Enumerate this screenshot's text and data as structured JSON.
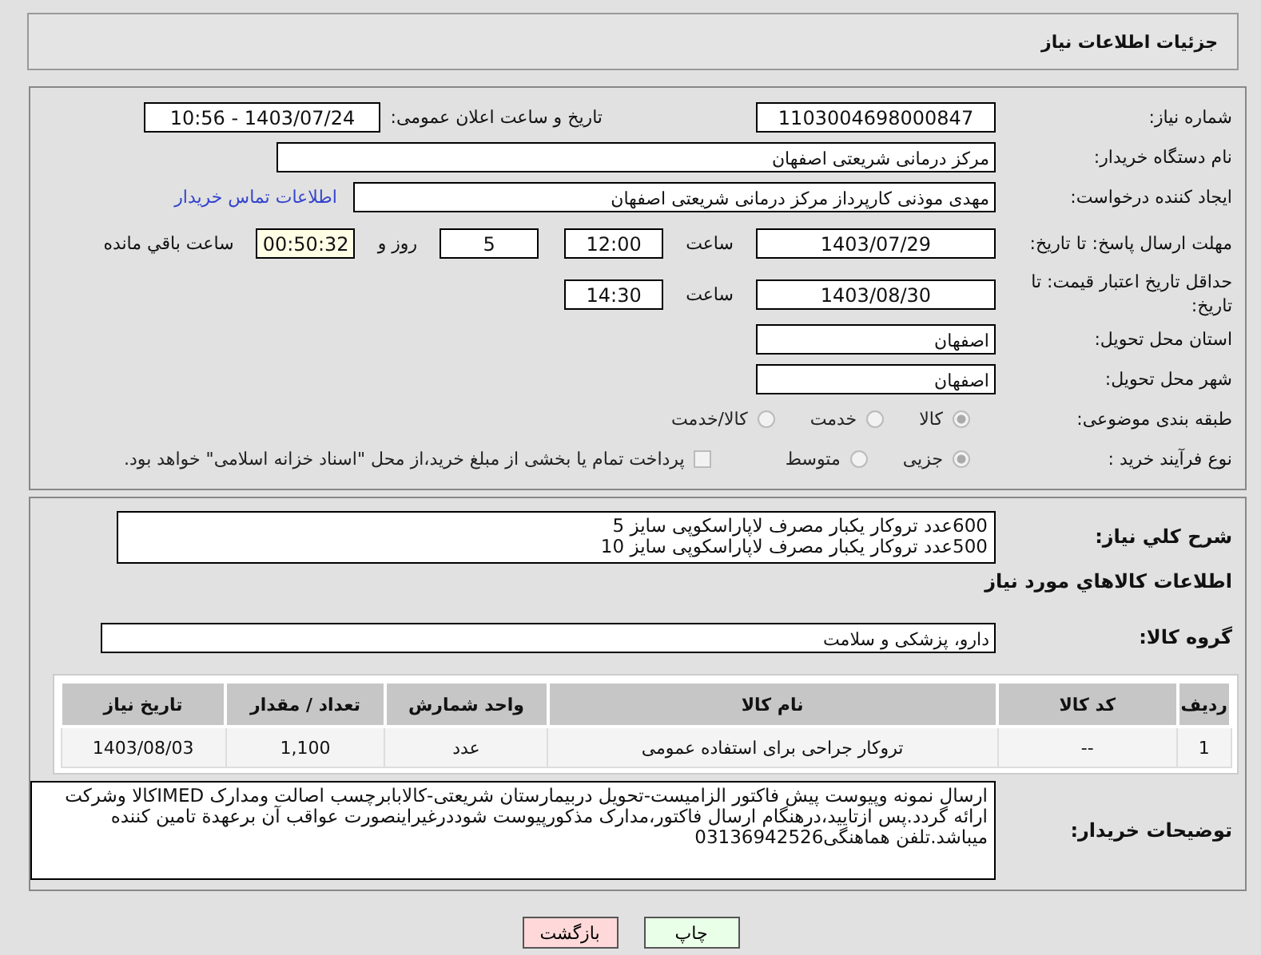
{
  "header": {
    "title": "جزئیات اطلاعات نیاز"
  },
  "need_number": {
    "label": "شماره نیاز:",
    "value": "1103004698000847"
  },
  "announce": {
    "label": "تاریخ و ساعت اعلان عمومی:",
    "value": "1403/07/24 - 10:56"
  },
  "buyer": {
    "label": "نام دستگاه خریدار:",
    "value": "مرکز درمانی شریعتی اصفهان"
  },
  "creator": {
    "label": "ایجاد کننده درخواست:",
    "value": "مهدی موذنی کارپرداز مرکز درمانی شریعتی اصفهان",
    "link": "اطلاعات تماس خریدار"
  },
  "deadline": {
    "label": "مهلت ارسال پاسخ: تا تاریخ:",
    "date": "1403/07/29",
    "time_label": "ساعت",
    "time": "12:00",
    "days": "5",
    "days_label": "روز و",
    "remaining": "00:50:32",
    "remaining_label": "ساعت باقي مانده"
  },
  "validity": {
    "label": "حداقل تاریخ اعتبار قیمت: تا تاریخ:",
    "date": "1403/08/30",
    "time_label": "ساعت",
    "time": "14:30"
  },
  "province": {
    "label": "استان محل تحویل:",
    "value": "اصفهان"
  },
  "city": {
    "label": "شهر محل تحویل:",
    "value": "اصفهان"
  },
  "category": {
    "label": "طبقه بندی موضوعی:",
    "options": [
      {
        "label": "کالا",
        "selected": true
      },
      {
        "label": "خدمت",
        "selected": false
      },
      {
        "label": "کالا/خدمت",
        "selected": false
      }
    ]
  },
  "process": {
    "label": "نوع فرآیند خرید :",
    "options": [
      {
        "label": "جزیی",
        "selected": true
      },
      {
        "label": "متوسط",
        "selected": false
      }
    ],
    "payment": {
      "label": "پرداخت تمام یا بخشی از مبلغ خرید،از محل \"اسناد خزانه اسلامی\" خواهد بود.",
      "checked": false
    }
  },
  "description": {
    "label": "شرح کلي نياز:",
    "lines": [
      "600عدد تروکار یکبار مصرف لاپاراسکوپی سایز 5",
      "500عدد تروکار یکبار مصرف لاپاراسکوپی سایز 10"
    ]
  },
  "goods_heading": "اطلاعات کالاهاي مورد نياز",
  "goods_group": {
    "label": "گروه کالا:",
    "value": "دارو، پزشکی و سلامت"
  },
  "table": {
    "columns": [
      "ردیف",
      "کد کالا",
      "نام کالا",
      "واحد شمارش",
      "تعداد / مقدار",
      "تاریخ نیاز"
    ],
    "rows": [
      [
        "1",
        "--",
        "تروکار جراحی برای استفاده عمومی",
        "عدد",
        "1,100",
        "1403/08/03"
      ]
    ]
  },
  "buyer_notes": {
    "label": "توضیحات خریدار:",
    "value": "ارسال نمونه وپیوست پیش فاکتور الزامیست-تحویل دربیمارستان شریعتی-کالابابرچسب اصالت ومدارک IMEDکالا وشرکت ارائه گردد.پس ازتایید،درهنگام ارسال فاکتور،مدارک مذکورپیوست شوددرغیراینصورت عواقب آن برعهدة تامین کننده  میباشد.تلفن هماهنگی03136942526"
  },
  "buttons": [
    {
      "label": "چاپ",
      "kind": "print"
    },
    {
      "label": "بازگشت",
      "kind": "back"
    }
  ]
}
